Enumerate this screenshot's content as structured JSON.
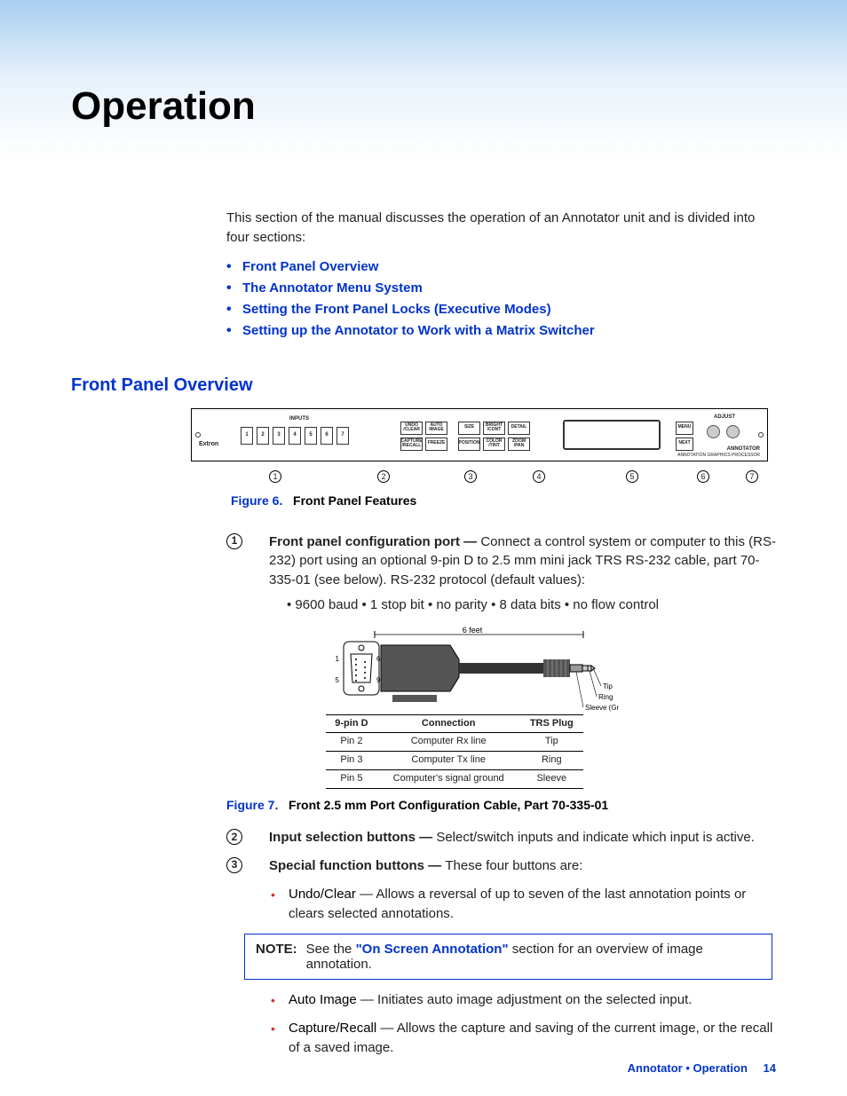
{
  "title": "Operation",
  "intro": "This section of the manual discusses the operation of an Annotator unit and is divided into four sections:",
  "toc": [
    "Front Panel Overview",
    "The Annotator Menu System",
    "Setting the Front Panel Locks (Executive Modes)",
    "Setting up the Annotator to Work with a Matrix Switcher"
  ],
  "section_heading": "Front Panel Overview",
  "panel": {
    "brand": "Extron",
    "inputs_label": "INPUTS",
    "adjust_label": "ADJUST",
    "annotator_label": "ANNOTATOR",
    "processor_label": "ANNOTATION GRAPHICS PROCESSOR",
    "input_nums": [
      "1",
      "2",
      "3",
      "4",
      "5",
      "6",
      "7"
    ],
    "fn_top": [
      "UNDO /CLEAR",
      "AUTO IMAGE"
    ],
    "fn_bot": [
      "CAPTURE /RECALL",
      "FREEZE"
    ],
    "pip_top": [
      "SIZE",
      "BRIGHT /CONT",
      "DETAIL"
    ],
    "pip_bot": [
      "POSITION",
      "COLOR /TINT",
      "ZOOM /PAN"
    ],
    "nav_top": "MENU",
    "nav_bot": "NEXT"
  },
  "callouts": [
    "1",
    "2",
    "3",
    "4",
    "5",
    "6",
    "7"
  ],
  "fig6": {
    "num": "Figure 6.",
    "title": "Front Panel Features"
  },
  "item1": {
    "marker": "1",
    "lead": "Front panel configuration port — ",
    "body": "Connect a control system or computer to this (RS-232) port using an optional 9-pin D to 2.5 mm mini jack TRS RS-232 cable, part 70-335-01 (see below). RS-232 protocol (default values):",
    "bullets": "• 9600 baud • 1 stop bit • no parity • 8 data bits • no flow control"
  },
  "cable": {
    "length": "6 feet",
    "pin1": "1",
    "pin5": "5",
    "pin6": "6",
    "pin9": "9",
    "tip": "Tip",
    "ring": "Ring",
    "sleeve": "Sleeve (Gnd)",
    "headers": [
      "9-pin D",
      "Connection",
      "TRS Plug"
    ],
    "rows": [
      [
        "Pin 2",
        "Computer Rx line",
        "Tip"
      ],
      [
        "Pin 3",
        "Computer Tx line",
        "Ring"
      ],
      [
        "Pin 5",
        "Computer's signal ground",
        "Sleeve"
      ]
    ]
  },
  "fig7": {
    "num": "Figure 7.",
    "title": "Front 2.5 mm Port Configuration Cable, Part 70-335-01"
  },
  "item2": {
    "marker": "2",
    "lead": "Input selection buttons — ",
    "body": "Select/switch inputs and indicate which input is active."
  },
  "item3": {
    "marker": "3",
    "lead": "Special function buttons — ",
    "body": "These four buttons are:"
  },
  "sf_bullets": [
    {
      "k": "Undo/Clear",
      "t": " —  Allows a reversal of up to seven of the last annotation points or clears selected annotations."
    }
  ],
  "note": {
    "label": "NOTE:",
    "pre": "See the ",
    "link": "\"On Screen Annotation\"",
    "post": " section for an overview of image annotation."
  },
  "sf_bullets2": [
    {
      "k": "Auto Image",
      "t": " — Initiates auto image adjustment on the selected input."
    },
    {
      "k": "Capture/Recall",
      "t": " — Allows the capture and saving of the current image, or the recall of a saved image."
    }
  ],
  "footer": {
    "text": "Annotator • Operation",
    "page": "14"
  }
}
